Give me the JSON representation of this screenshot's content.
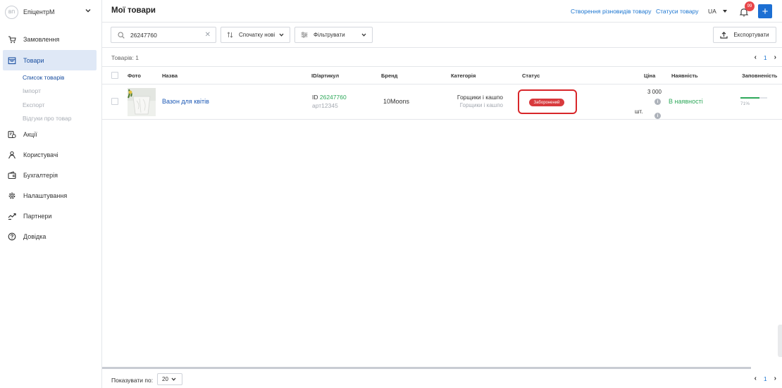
{
  "brand": {
    "avatar_initials": "ВП",
    "name": "ЕпіцентрМ"
  },
  "sidebar": {
    "items": [
      {
        "label": "Замовлення",
        "icon": "cart-icon"
      },
      {
        "label": "Товари",
        "icon": "box-icon",
        "active": true
      },
      {
        "label": "Акції",
        "icon": "promo-icon"
      },
      {
        "label": "Користувачі",
        "icon": "users-icon"
      },
      {
        "label": "Бухгалтерія",
        "icon": "wallet-icon"
      },
      {
        "label": "Налаштування",
        "icon": "gear-icon"
      },
      {
        "label": "Партнери",
        "icon": "handshake-icon"
      },
      {
        "label": "Довідка",
        "icon": "help-icon"
      }
    ],
    "sub_items": [
      {
        "label": "Список товарів",
        "active": true
      },
      {
        "label": "Імпорт"
      },
      {
        "label": "Експорт"
      },
      {
        "label": "Відгуки про товар"
      }
    ]
  },
  "header": {
    "title": "Мої товари",
    "link_variants": "Створення різновидів товару",
    "link_statuses": "Статуси товару",
    "language": "UA",
    "notifications_count": "99",
    "add_button": "+"
  },
  "toolbar": {
    "search_value": "26247760",
    "sort_label": "Спочатку нові",
    "filter_label": "Фільтрувати",
    "export_label": "Експортувати"
  },
  "list": {
    "count_text": "Товарів: 1",
    "page": "1",
    "columns": {
      "photo": "Фото",
      "name": "Назва",
      "id": "ID/артикул",
      "brand": "Бренд",
      "category": "Категорія",
      "status": "Статус",
      "price": "Ціна",
      "availability": "Наявність",
      "fill": "Заповненість"
    },
    "rows": [
      {
        "name": "Вазон для квітів",
        "id_prefix": "ID ",
        "id_value": "26247760",
        "article": "арт12345",
        "brand": "10Moons",
        "category": "Горщики і кашпо",
        "subcategory": "Горщики і кашпо",
        "status": "Заборонений",
        "price": "3 000",
        "unit": "шт.",
        "availability": "В наявності",
        "fill_percent": 71,
        "fill_text": "71%"
      }
    ]
  },
  "footer": {
    "per_page_label": "Показувати по:",
    "per_page_value": "20",
    "page": "1"
  },
  "colors": {
    "accent": "#1c6fd3",
    "link": "#1b75d0",
    "success": "#2ea85a",
    "danger": "#d83a3d",
    "active_bg": "#dfe8f6"
  }
}
